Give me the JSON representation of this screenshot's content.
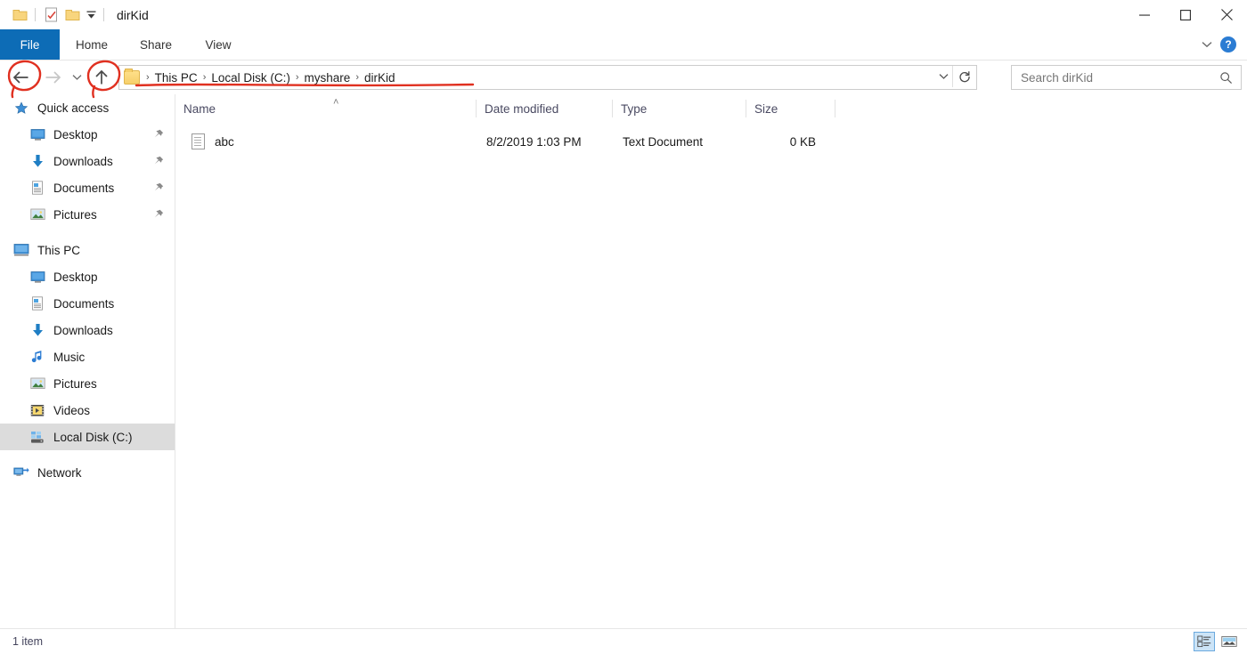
{
  "window": {
    "title": "dirKid",
    "quick_access_toolbar": [
      {
        "name": "folder-icon",
        "label": "Folder"
      },
      {
        "name": "properties-icon",
        "label": "Properties"
      },
      {
        "name": "new-folder-icon",
        "label": "New folder"
      },
      {
        "name": "chevron-down-icon",
        "label": "Customize Quick Access Toolbar"
      }
    ],
    "controls": {
      "minimize": "—",
      "maximize": "□",
      "close": "✕"
    }
  },
  "ribbon": {
    "tabs": [
      {
        "label": "File",
        "active": true
      },
      {
        "label": "Home",
        "active": false
      },
      {
        "label": "Share",
        "active": false
      },
      {
        "label": "View",
        "active": false
      }
    ],
    "expand_label": "Expand the Ribbon",
    "help_label": "?"
  },
  "addressbar": {
    "back_label": "Back",
    "forward_label": "Forward",
    "history_label": "Recent locations",
    "up_label": "Up to myshare",
    "breadcrumbs": [
      "This PC",
      "Local Disk (C:)",
      "myshare",
      "dirKid"
    ],
    "separator": "›",
    "dropdown_label": "Previous locations",
    "refresh_label": "Refresh"
  },
  "search": {
    "placeholder": "Search dirKid"
  },
  "annotations": {
    "color": "#e03020",
    "items": [
      {
        "name": "annotation-circle-back",
        "target": "back-button"
      },
      {
        "name": "annotation-circle-up",
        "target": "up-button"
      },
      {
        "name": "annotation-underline-path",
        "target": "breadcrumb"
      }
    ]
  },
  "sidebar": {
    "groups": [
      {
        "header": {
          "label": "Quick access",
          "icon": "star-icon"
        },
        "items": [
          {
            "label": "Desktop",
            "icon": "desktop-icon",
            "pinned": true,
            "selected": false
          },
          {
            "label": "Downloads",
            "icon": "download-icon",
            "pinned": true,
            "selected": false
          },
          {
            "label": "Documents",
            "icon": "document-icon",
            "pinned": true,
            "selected": false
          },
          {
            "label": "Pictures",
            "icon": "pictures-icon",
            "pinned": true,
            "selected": false
          }
        ]
      },
      {
        "header": {
          "label": "This PC",
          "icon": "this-pc-icon"
        },
        "items": [
          {
            "label": "Desktop",
            "icon": "desktop-icon",
            "pinned": false,
            "selected": false
          },
          {
            "label": "Documents",
            "icon": "document-icon",
            "pinned": false,
            "selected": false
          },
          {
            "label": "Downloads",
            "icon": "download-icon",
            "pinned": false,
            "selected": false
          },
          {
            "label": "Music",
            "icon": "music-icon",
            "pinned": false,
            "selected": false
          },
          {
            "label": "Pictures",
            "icon": "pictures-icon",
            "pinned": false,
            "selected": false
          },
          {
            "label": "Videos",
            "icon": "videos-icon",
            "pinned": false,
            "selected": false
          },
          {
            "label": "Local Disk (C:)",
            "icon": "drive-icon",
            "pinned": false,
            "selected": true
          }
        ]
      },
      {
        "header": {
          "label": "Network",
          "icon": "network-icon"
        },
        "items": []
      }
    ]
  },
  "filelist": {
    "columns": [
      {
        "label": "Name",
        "sorted": "asc"
      },
      {
        "label": "Date modified",
        "sorted": ""
      },
      {
        "label": "Type",
        "sorted": ""
      },
      {
        "label": "Size",
        "sorted": ""
      }
    ],
    "sort_caret": "˄",
    "rows": [
      {
        "name": "abc",
        "icon": "text-file-icon",
        "date_modified": "8/2/2019 1:03 PM",
        "type": "Text Document",
        "size": "0 KB"
      }
    ]
  },
  "statusbar": {
    "item_count": "1 item",
    "views": [
      {
        "name": "details-view-button",
        "label": "Details view",
        "active": true
      },
      {
        "name": "large-icons-view-button",
        "label": "Large icons view",
        "active": false
      }
    ]
  }
}
